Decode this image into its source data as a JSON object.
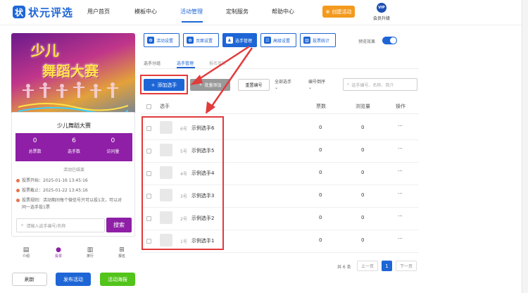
{
  "brand": {
    "name": "状元评选",
    "mark": "状"
  },
  "nav": [
    "用户首页",
    "模板中心",
    "活动管理",
    "定制服务",
    "帮助中心"
  ],
  "create_btn": "创建活动",
  "vip": {
    "badge": "VIP",
    "label": "会员升级"
  },
  "preview": {
    "banner_line1": "少儿",
    "banner_line2": "舞蹈大赛",
    "activity_name": "少儿舞蹈大赛",
    "stats": [
      {
        "value": "0",
        "label": "总票数"
      },
      {
        "value": "6",
        "label": "选手数"
      },
      {
        "value": "0",
        "label": "访问量"
      }
    ],
    "status": "活动已结束",
    "vote_start": "投票开始：2025-01-16 13:45:16",
    "vote_end": "投票截止：2025-01-22 13:45:16",
    "rule_1": "投票规则：活动期间每个微信号只可以投1次，可以对",
    "rule_2": "同一选手投1票",
    "search_placeholder": "请输入选手编号/名称",
    "search_btn": "搜索",
    "tabs": [
      "介绍",
      "投票",
      "排行",
      "报名"
    ]
  },
  "bottom_buttons": [
    "刷新",
    "发布活动",
    "活动海报"
  ],
  "toolbar": [
    "活动设置",
    "页面设置",
    "选手管理",
    "高级设置",
    "投票统计"
  ],
  "toggle_label": "预览效果",
  "subtabs": [
    "选手分组",
    "选手管理",
    "报名审核"
  ],
  "actions": {
    "add": "添加选手",
    "batch": "批量添加",
    "renumber": "重置编号",
    "filter_group": "全部选手",
    "filter_sort": "编号倒序",
    "search_placeholder": "选手编号、名称、简介"
  },
  "table": {
    "headers": [
      "选手",
      "票数",
      "浏览量",
      "操作"
    ],
    "rows": [
      {
        "num": "6号",
        "name": "示例选手6",
        "votes": "0",
        "views": "0",
        "op": "···"
      },
      {
        "num": "5号",
        "name": "示例选手5",
        "votes": "0",
        "views": "0",
        "op": "···"
      },
      {
        "num": "4号",
        "name": "示例选手4",
        "votes": "0",
        "views": "0",
        "op": "···"
      },
      {
        "num": "3号",
        "name": "示例选手3",
        "votes": "0",
        "views": "0",
        "op": "···"
      },
      {
        "num": "2号",
        "name": "示例选手2",
        "votes": "0",
        "views": "0",
        "op": "···"
      },
      {
        "num": "1号",
        "name": "示例选手1",
        "votes": "0",
        "views": "0",
        "op": "···"
      }
    ]
  },
  "pagination": {
    "total": "共 6 条",
    "prev": "上一页",
    "current": "1",
    "next": "下一页"
  },
  "colors": {
    "primary": "#1e66d6",
    "purple": "#8e1fa6",
    "orange": "#f39a1e",
    "green": "#52c41a",
    "highlight": "#e23b3b"
  }
}
